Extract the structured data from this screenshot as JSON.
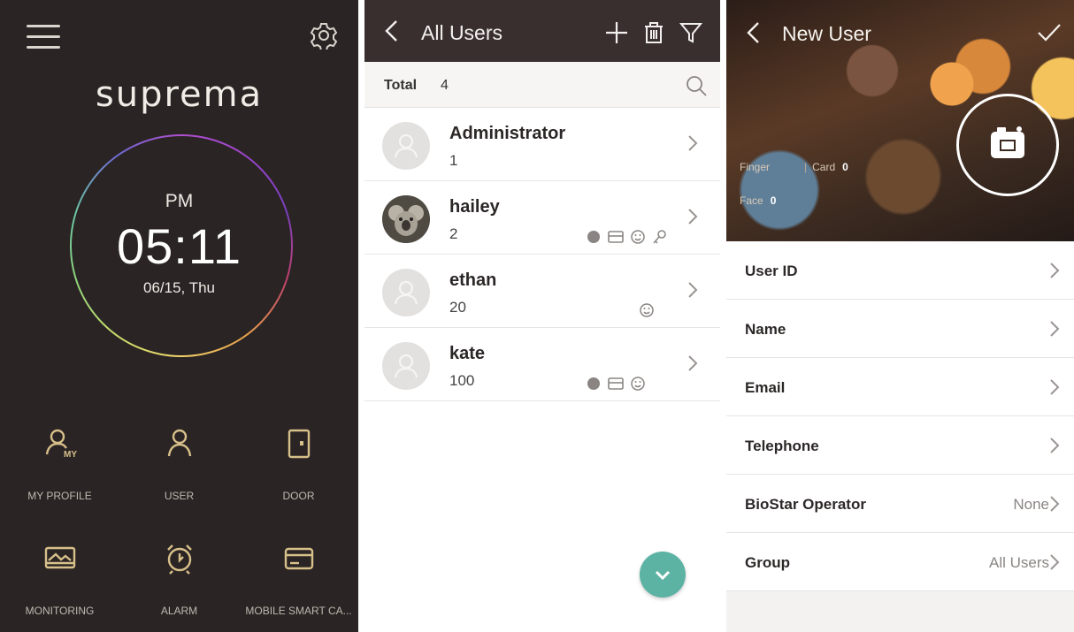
{
  "home": {
    "logo": "suprema",
    "ampm": "PM",
    "time": "05:11",
    "date": "06/15, Thu",
    "accent_color": "#d8c08a",
    "tiles": [
      {
        "label": "MY PROFILE",
        "icon": "my-profile-icon"
      },
      {
        "label": "USER",
        "icon": "user-icon"
      },
      {
        "label": "DOOR",
        "icon": "door-icon"
      },
      {
        "label": "MONITORING",
        "icon": "monitoring-icon"
      },
      {
        "label": "ALARM",
        "icon": "alarm-clock-icon"
      },
      {
        "label": "MOBILE SMART CA...",
        "icon": "card-icon"
      }
    ]
  },
  "users": {
    "title": "All Users",
    "total_label": "Total",
    "total_count": "4",
    "header_color": "#3a2f2f",
    "fab_color": "#5cb2a3",
    "list": [
      {
        "name": "Administrator",
        "id": "1",
        "credentials": []
      },
      {
        "name": "hailey",
        "id": "2",
        "credentials": [
          "fingerprint-icon",
          "card-icon",
          "face-icon",
          "key-icon"
        ]
      },
      {
        "name": "ethan",
        "id": "20",
        "credentials": [
          "face-icon"
        ]
      },
      {
        "name": "kate",
        "id": "100",
        "credentials": [
          "fingerprint-icon",
          "card-icon",
          "face-icon"
        ]
      }
    ]
  },
  "new_user": {
    "title": "New User",
    "finger_label": "Finger",
    "card_label": "Card",
    "card_count": "0",
    "face_label": "Face",
    "face_count": "0",
    "fields": [
      {
        "label": "User ID",
        "value": ""
      },
      {
        "label": "Name",
        "value": ""
      },
      {
        "label": "Email",
        "value": ""
      },
      {
        "label": "Telephone",
        "value": ""
      },
      {
        "label": "BioStar Operator",
        "value": "None"
      },
      {
        "label": "Group",
        "value": "All Users"
      }
    ]
  }
}
